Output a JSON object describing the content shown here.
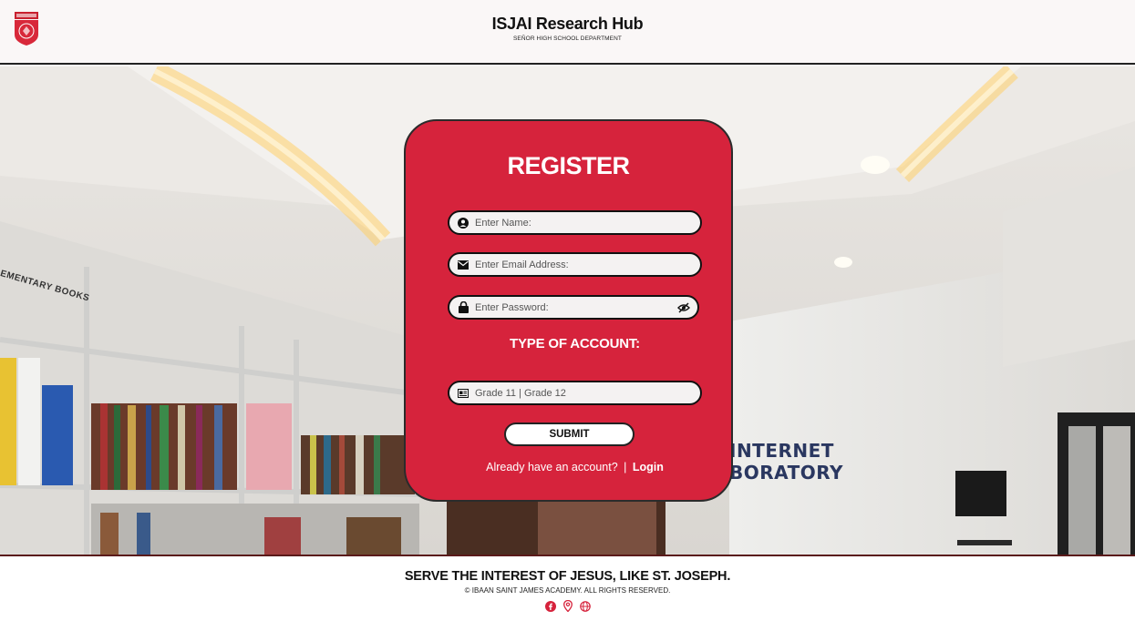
{
  "header": {
    "title": "ISJAI Research Hub",
    "subtitle": "SEÑOR HIGH SCHOOL DEPARTMENT",
    "logo_icon": "school-crest-icon"
  },
  "background": {
    "sign_line1": "INTERNET",
    "sign_line2": "BORATORY",
    "shelf_label": "EMENTARY BOOKS"
  },
  "register": {
    "title": "REGISTER",
    "name_placeholder": "Enter Name:",
    "email_placeholder": "Enter Email Address:",
    "password_placeholder": "Enter Password:",
    "account_type_label": "TYPE OF ACCOUNT:",
    "grade_placeholder": "Grade 11 | Grade 12",
    "submit_label": "SUBMIT",
    "already_text": "Already have an account?",
    "separator": "|",
    "login_link": "Login",
    "icons": [
      "user-icon",
      "envelope-icon",
      "lock-icon",
      "eye-slash-icon",
      "id-card-icon"
    ]
  },
  "footer": {
    "motto": "SERVE THE INTEREST OF JESUS, LIKE ST. JOSEPH.",
    "copyright": "© IBAAN SAINT JAMES ACADEMY. ALL RIGHTS RESERVED.",
    "social_icons": [
      "facebook-icon",
      "location-pin-icon",
      "globe-icon"
    ]
  },
  "colors": {
    "accent": "#d6233c",
    "header_bg": "#faf7f7",
    "social": "#d6233c"
  }
}
